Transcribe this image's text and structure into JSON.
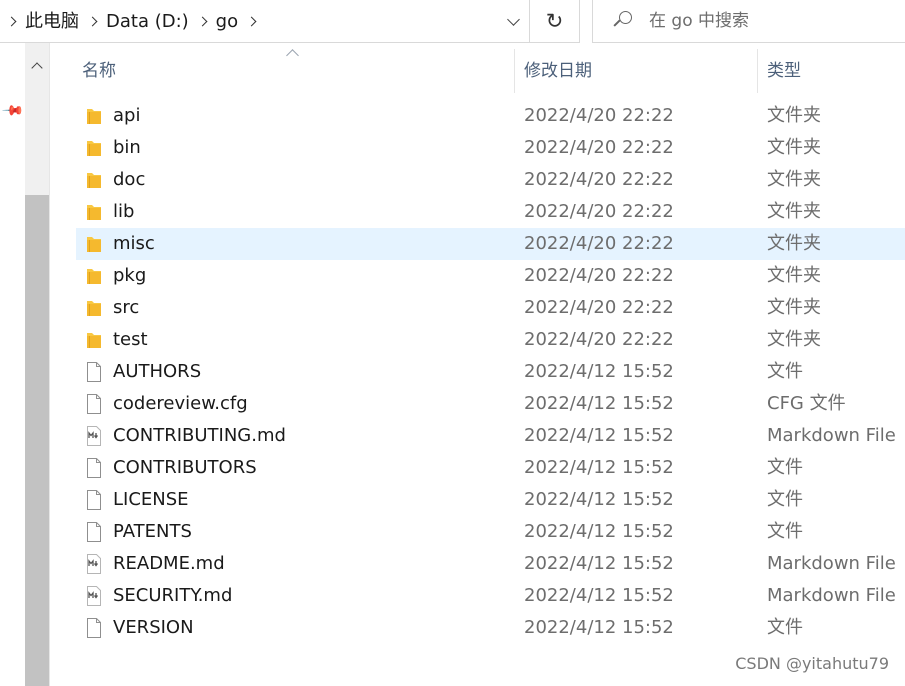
{
  "address_bar": {
    "crumbs": [
      "此电脑",
      "Data (D:)",
      "go"
    ]
  },
  "search": {
    "placeholder": "在 go 中搜索"
  },
  "nav_pane": {
    "cut_text": ")"
  },
  "columns": {
    "name": "名称",
    "date": "修改日期",
    "type": "类型"
  },
  "files": [
    {
      "name": "api",
      "date": "2022/4/20 22:22",
      "type": "文件夹",
      "icon": "folder-icon"
    },
    {
      "name": "bin",
      "date": "2022/4/20 22:22",
      "type": "文件夹",
      "icon": "folder-icon"
    },
    {
      "name": "doc",
      "date": "2022/4/20 22:22",
      "type": "文件夹",
      "icon": "folder-icon"
    },
    {
      "name": "lib",
      "date": "2022/4/20 22:22",
      "type": "文件夹",
      "icon": "folder-icon"
    },
    {
      "name": "misc",
      "date": "2022/4/20 22:22",
      "type": "文件夹",
      "icon": "folder-icon",
      "selected": true
    },
    {
      "name": "pkg",
      "date": "2022/4/20 22:22",
      "type": "文件夹",
      "icon": "folder-icon"
    },
    {
      "name": "src",
      "date": "2022/4/20 22:22",
      "type": "文件夹",
      "icon": "folder-icon"
    },
    {
      "name": "test",
      "date": "2022/4/20 22:22",
      "type": "文件夹",
      "icon": "folder-icon"
    },
    {
      "name": "AUTHORS",
      "date": "2022/4/12 15:52",
      "type": "文件",
      "icon": "file-icon"
    },
    {
      "name": "codereview.cfg",
      "date": "2022/4/12 15:52",
      "type": "CFG 文件",
      "icon": "file-icon"
    },
    {
      "name": "CONTRIBUTING.md",
      "date": "2022/4/12 15:52",
      "type": "Markdown File",
      "icon": "markdown-file-icon"
    },
    {
      "name": "CONTRIBUTORS",
      "date": "2022/4/12 15:52",
      "type": "文件",
      "icon": "file-icon"
    },
    {
      "name": "LICENSE",
      "date": "2022/4/12 15:52",
      "type": "文件",
      "icon": "file-icon"
    },
    {
      "name": "PATENTS",
      "date": "2022/4/12 15:52",
      "type": "文件",
      "icon": "file-icon"
    },
    {
      "name": "README.md",
      "date": "2022/4/12 15:52",
      "type": "Markdown File",
      "icon": "markdown-file-icon"
    },
    {
      "name": "SECURITY.md",
      "date": "2022/4/12 15:52",
      "type": "Markdown File",
      "icon": "markdown-file-icon"
    },
    {
      "name": "VERSION",
      "date": "2022/4/12 15:52",
      "type": "文件",
      "icon": "file-icon"
    }
  ],
  "watermark": "CSDN @yitahutu79",
  "colors": {
    "selection": "#e5f3ff",
    "folder": "#f8c843",
    "header_text": "#4c607a",
    "secondary_text": "#6d6d6d"
  }
}
